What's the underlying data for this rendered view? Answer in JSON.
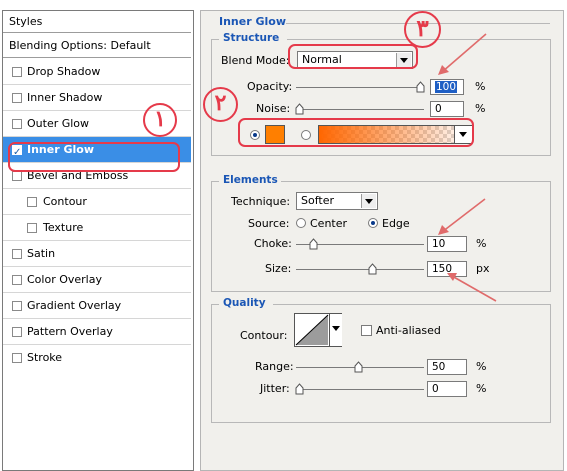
{
  "styles_panel": {
    "title": "Styles",
    "blending": "Blending Options: Default",
    "items": [
      {
        "label": "Drop Shadow",
        "checked": false,
        "indent": false
      },
      {
        "label": "Inner Shadow",
        "checked": false,
        "indent": false
      },
      {
        "label": "Outer Glow",
        "checked": false,
        "indent": false
      },
      {
        "label": "Inner Glow",
        "checked": true,
        "indent": false
      },
      {
        "label": "Bevel and Emboss",
        "checked": false,
        "indent": false
      },
      {
        "label": "Contour",
        "checked": false,
        "indent": true
      },
      {
        "label": "Texture",
        "checked": false,
        "indent": true
      },
      {
        "label": "Satin",
        "checked": false,
        "indent": false
      },
      {
        "label": "Color Overlay",
        "checked": false,
        "indent": false
      },
      {
        "label": "Gradient Overlay",
        "checked": false,
        "indent": false
      },
      {
        "label": "Pattern Overlay",
        "checked": false,
        "indent": false
      },
      {
        "label": "Stroke",
        "checked": false,
        "indent": false
      }
    ]
  },
  "inner_glow": {
    "title": "Inner Glow",
    "structure": {
      "title": "Structure",
      "blend_mode_label": "Blend Mode:",
      "blend_mode_value": "Normal",
      "opacity_label": "Opacity:",
      "opacity_value": "100",
      "opacity_unit": "%",
      "noise_label": "Noise:",
      "noise_value": "0",
      "noise_unit": "%",
      "glow_color": "#ff7f00"
    },
    "elements": {
      "title": "Elements",
      "technique_label": "Technique:",
      "technique_value": "Softer",
      "source_label": "Source:",
      "source_center": "Center",
      "source_edge": "Edge",
      "choke_label": "Choke:",
      "choke_value": "10",
      "choke_unit": "%",
      "size_label": "Size:",
      "size_value": "150",
      "size_unit": "px"
    },
    "quality": {
      "title": "Quality",
      "contour_label": "Contour:",
      "anti_aliased_label": "Anti-aliased",
      "range_label": "Range:",
      "range_value": "50",
      "range_unit": "%",
      "jitter_label": "Jitter:",
      "jitter_value": "0",
      "jitter_unit": "%"
    }
  },
  "annotations": {
    "one": "١",
    "two": "٢",
    "three": "٣"
  },
  "colors": {
    "annotation_red": "#e53a4a",
    "selection_blue": "#3a8ee6",
    "section_blue": "#1a56b5"
  }
}
